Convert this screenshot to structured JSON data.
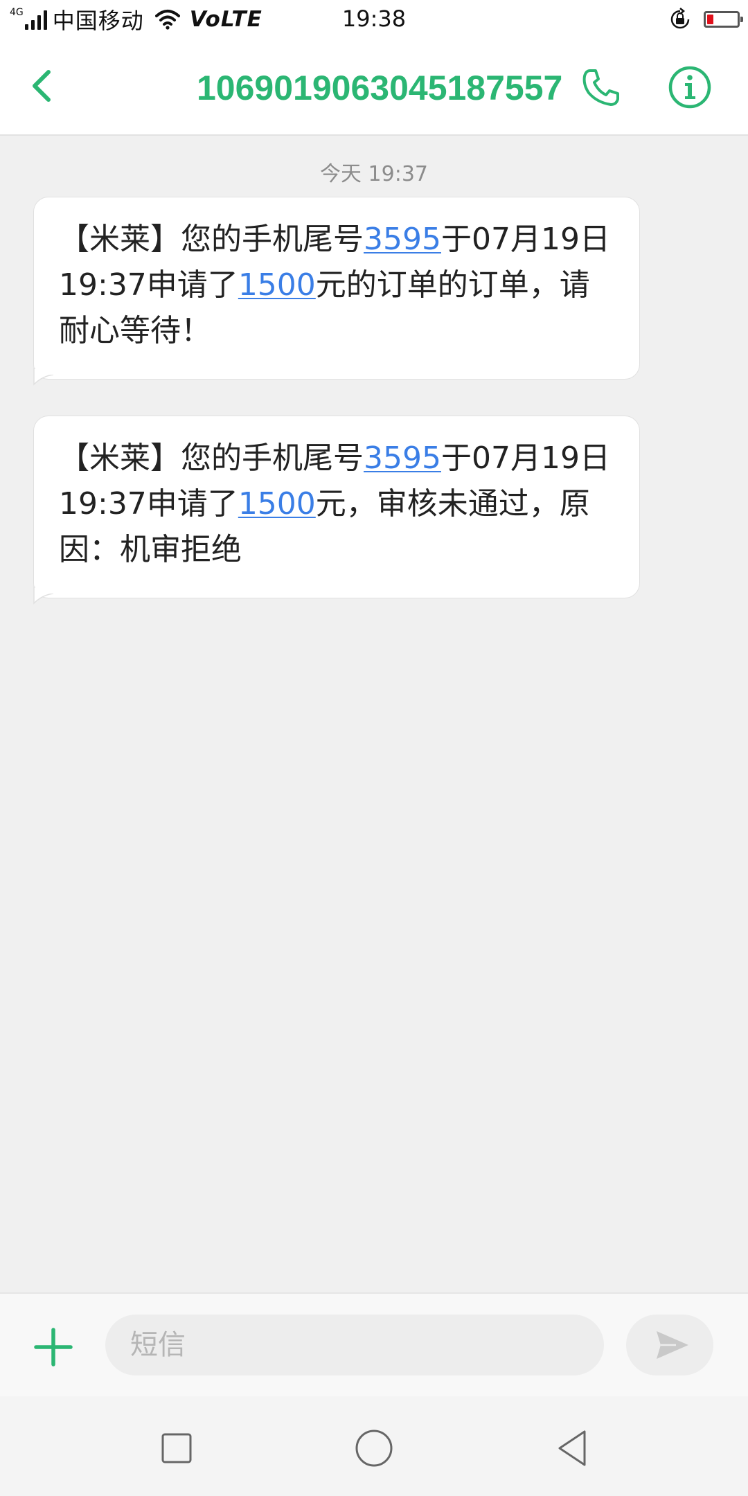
{
  "status_bar": {
    "network_type": "4G",
    "carrier": "中国移动",
    "volte": "VoLTE",
    "time": "19:38",
    "battery_color": "#e0101b"
  },
  "header": {
    "back_icon": "chevron-left-icon",
    "contact_number": "1069019063045187557",
    "call_icon": "phone-icon",
    "info_icon": "info-icon",
    "accent_color": "#2bb673"
  },
  "thread": {
    "date_divider": "今天 19:37",
    "messages": [
      {
        "segments": [
          {
            "text": "【米莱】您的手机尾号",
            "link": false
          },
          {
            "text": "3595",
            "link": true
          },
          {
            "text": "于07月19日19:37申请了",
            "link": false
          },
          {
            "text": "1500",
            "link": true
          },
          {
            "text": "元的订单的订单，请耐心等待！",
            "link": false
          }
        ]
      },
      {
        "segments": [
          {
            "text": "【米莱】您的手机尾号",
            "link": false
          },
          {
            "text": "3595",
            "link": true
          },
          {
            "text": "于07月19日19:37申请了",
            "link": false
          },
          {
            "text": "1500",
            "link": true
          },
          {
            "text": "元，审核未通过，原因：机审拒绝",
            "link": false
          }
        ]
      }
    ]
  },
  "composer": {
    "add_icon": "plus-icon",
    "placeholder": "短信",
    "value": "",
    "send_icon": "send-icon"
  },
  "nav_bar": {
    "recent_icon": "square-icon",
    "home_icon": "circle-icon",
    "back_icon": "triangle-back-icon"
  }
}
